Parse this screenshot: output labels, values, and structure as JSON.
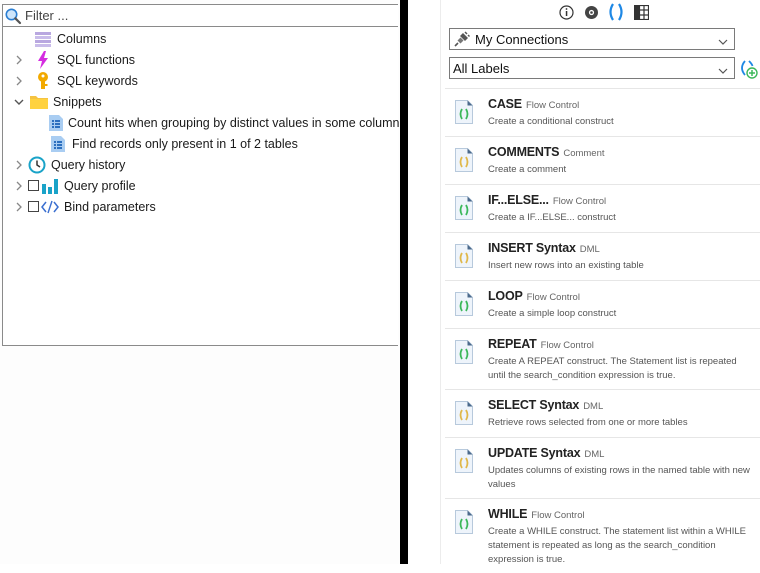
{
  "left_panel": {
    "filter": {
      "placeholder": "Filter ..."
    },
    "tree": [
      {
        "label": "Columns",
        "icon": "columns-icon",
        "expander": "none",
        "level": 0
      },
      {
        "label": "SQL functions",
        "icon": "lightning-icon",
        "expander": "collapsed",
        "level": 0
      },
      {
        "label": "SQL keywords",
        "icon": "key-icon",
        "expander": "collapsed",
        "level": 0
      },
      {
        "label": "Snippets",
        "icon": "folder-icon",
        "expander": "expanded",
        "level": 0
      },
      {
        "label": "Count hits when grouping by distinct values in some column",
        "icon": "snippet-doc-icon",
        "expander": "none",
        "level": 1
      },
      {
        "label": "Find records only present in 1 of 2 tables",
        "icon": "snippet-doc-icon",
        "expander": "none",
        "level": 1
      },
      {
        "label": "Query history",
        "icon": "clock-icon",
        "expander": "collapsed",
        "level": 0
      },
      {
        "label": "Query profile",
        "icon": "bar-chart-icon",
        "expander": "collapsed",
        "level": 0,
        "checkbox": false
      },
      {
        "label": "Bind parameters",
        "icon": "code-tag-icon",
        "expander": "collapsed",
        "level": 0,
        "checkbox": false
      }
    ]
  },
  "right_panel": {
    "toolbar": [
      {
        "name": "info-icon",
        "active": false
      },
      {
        "name": "eye-icon",
        "active": false
      },
      {
        "name": "parentheses-icon",
        "active": true
      },
      {
        "name": "grid-icon",
        "active": false
      }
    ],
    "connection_select": {
      "value": "My Connections",
      "icon": "plug-icon"
    },
    "labels_select": {
      "value": "All Labels"
    },
    "add_snippet_icon": "add-snippet-icon",
    "snippets": [
      {
        "name": "CASE",
        "category": "Flow Control",
        "description": "Create a conditional construct",
        "color": "green"
      },
      {
        "name": "COMMENTS",
        "category": "Comment",
        "description": "Create a comment",
        "color": "yellow"
      },
      {
        "name": "IF...ELSE...",
        "category": "Flow Control",
        "description": "Create a IF...ELSE... construct",
        "color": "green"
      },
      {
        "name": "INSERT Syntax",
        "category": "DML",
        "description": "Insert new rows into an existing table",
        "color": "yellow"
      },
      {
        "name": "LOOP",
        "category": "Flow Control",
        "description": "Create a simple loop construct",
        "color": "green"
      },
      {
        "name": "REPEAT",
        "category": "Flow Control",
        "description": "Create A REPEAT construct. The Statement list is repeated until the search_condition expression is true.",
        "color": "green"
      },
      {
        "name": "SELECT Syntax",
        "category": "DML",
        "description": "Retrieve rows selected from one or more tables",
        "color": "yellow"
      },
      {
        "name": "UPDATE Syntax",
        "category": "DML",
        "description": "Updates columns of existing rows in the named table with new values",
        "color": "yellow"
      },
      {
        "name": "WHILE",
        "category": "Flow Control",
        "description": "Create a WHILE construct. The statement list within a WHILE statement is repeated as long as the search_condition expression is true.",
        "color": "green"
      }
    ]
  },
  "colors": {
    "accent_blue": "#1e88e5",
    "snippet_green": "#3cb85a",
    "snippet_yellow": "#e0b84a",
    "divider": "#000000"
  }
}
